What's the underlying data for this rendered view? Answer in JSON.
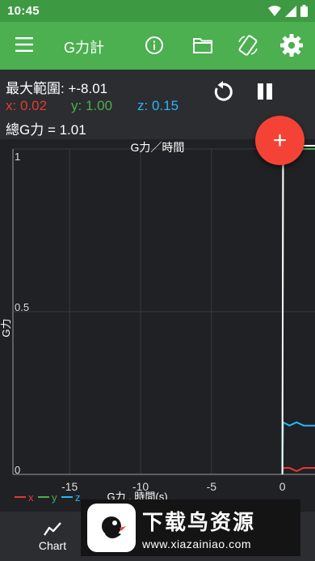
{
  "status": {
    "time": "10:45"
  },
  "appbar": {
    "title": "G力計"
  },
  "readout": {
    "max_range": "最大範圍: +-8.01",
    "x": "x: 0.02",
    "y": "y: 1.00",
    "z": "z: 0.15",
    "total": "總G力 = 1.01"
  },
  "colors": {
    "x": "#e53935",
    "y": "#4caf50",
    "z": "#29b6f6",
    "accent": "#4caf50",
    "fab": "#f44336"
  },
  "chart_data": {
    "type": "line",
    "title": "G力／時間",
    "xlabel": "G力 , 時間(s)",
    "ylabel": "G力",
    "xlim": [
      -19,
      2.3
    ],
    "ylim": [
      0,
      1
    ],
    "x_ticks": [
      "-15",
      "-10",
      "-5",
      "0"
    ],
    "x_tick_values": [
      -15,
      -10,
      -5,
      0
    ],
    "y_ticks": [
      "0",
      "0.5",
      "1"
    ],
    "y_tick_values": [
      0,
      0.5,
      1
    ],
    "legend": [
      "x",
      "y",
      "z"
    ],
    "series": [
      {
        "name": "x",
        "x": [
          0,
          0.05,
          0.5,
          1.0,
          1.5,
          2.0,
          2.3
        ],
        "y": [
          0.0,
          0.02,
          0.02,
          0.01,
          0.02,
          0.02,
          0.02
        ]
      },
      {
        "name": "y",
        "x": [
          0,
          0.05,
          0.5,
          1.0,
          1.5,
          2.0,
          2.3
        ],
        "y": [
          0.0,
          0.99,
          1.0,
          0.99,
          1.0,
          1.0,
          1.0
        ]
      },
      {
        "name": "z",
        "x": [
          0,
          0.05,
          0.5,
          1.0,
          1.5,
          2.0,
          2.3
        ],
        "y": [
          0.0,
          0.16,
          0.15,
          0.16,
          0.15,
          0.15,
          0.15
        ]
      },
      {
        "name": "total",
        "x": [
          0,
          0.05,
          0.5,
          1.0,
          1.5,
          2.0,
          2.3
        ],
        "y": [
          0.0,
          1.01,
          1.01,
          1.0,
          1.01,
          1.01,
          1.01
        ]
      }
    ]
  },
  "fab": {
    "label": "+"
  },
  "bottom_nav": {
    "chart_label": "Chart"
  },
  "watermark": {
    "title": "下载鸟资源",
    "url": "www.xiazainiao.com"
  }
}
